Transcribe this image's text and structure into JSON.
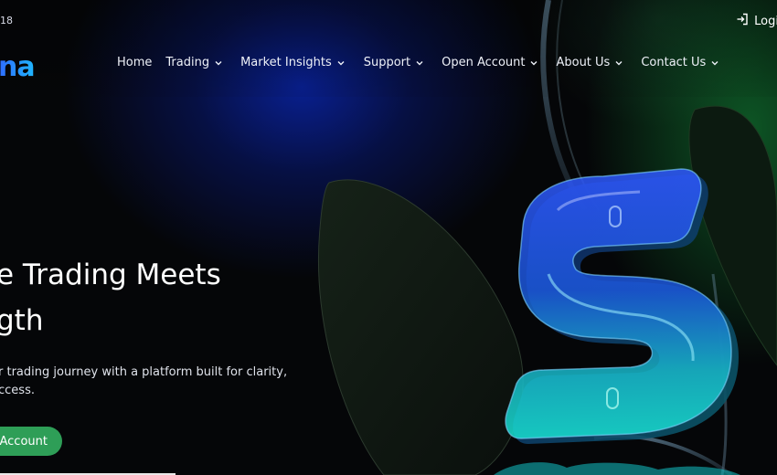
{
  "topbar": {
    "left_text": "18",
    "login_label": "Logi"
  },
  "brand": {
    "logo_text": "na",
    "colors": {
      "logo_blue": "#1f7bff",
      "cta_green": "#2e9e57"
    }
  },
  "nav": {
    "items": [
      {
        "label": "Home",
        "dropdown": false
      },
      {
        "label": "Trading",
        "dropdown": true
      },
      {
        "label": "Market Insights",
        "dropdown": true
      },
      {
        "label": "Support",
        "dropdown": true
      },
      {
        "label": "Open Account",
        "dropdown": true
      },
      {
        "label": "About Us",
        "dropdown": true
      },
      {
        "label": "Contact Us",
        "dropdown": true
      }
    ]
  },
  "hero": {
    "title_line1": "e Trading Meets",
    "title_line2": "gth",
    "description_line1": "r trading journey with a platform built for clarity,",
    "description_line2": "ccess.",
    "cta_label": "Account"
  },
  "icons": {
    "login": "login-icon",
    "chevron": "chevron-down-icon",
    "hero_graphic": "stylized-s-logo-graphic"
  }
}
